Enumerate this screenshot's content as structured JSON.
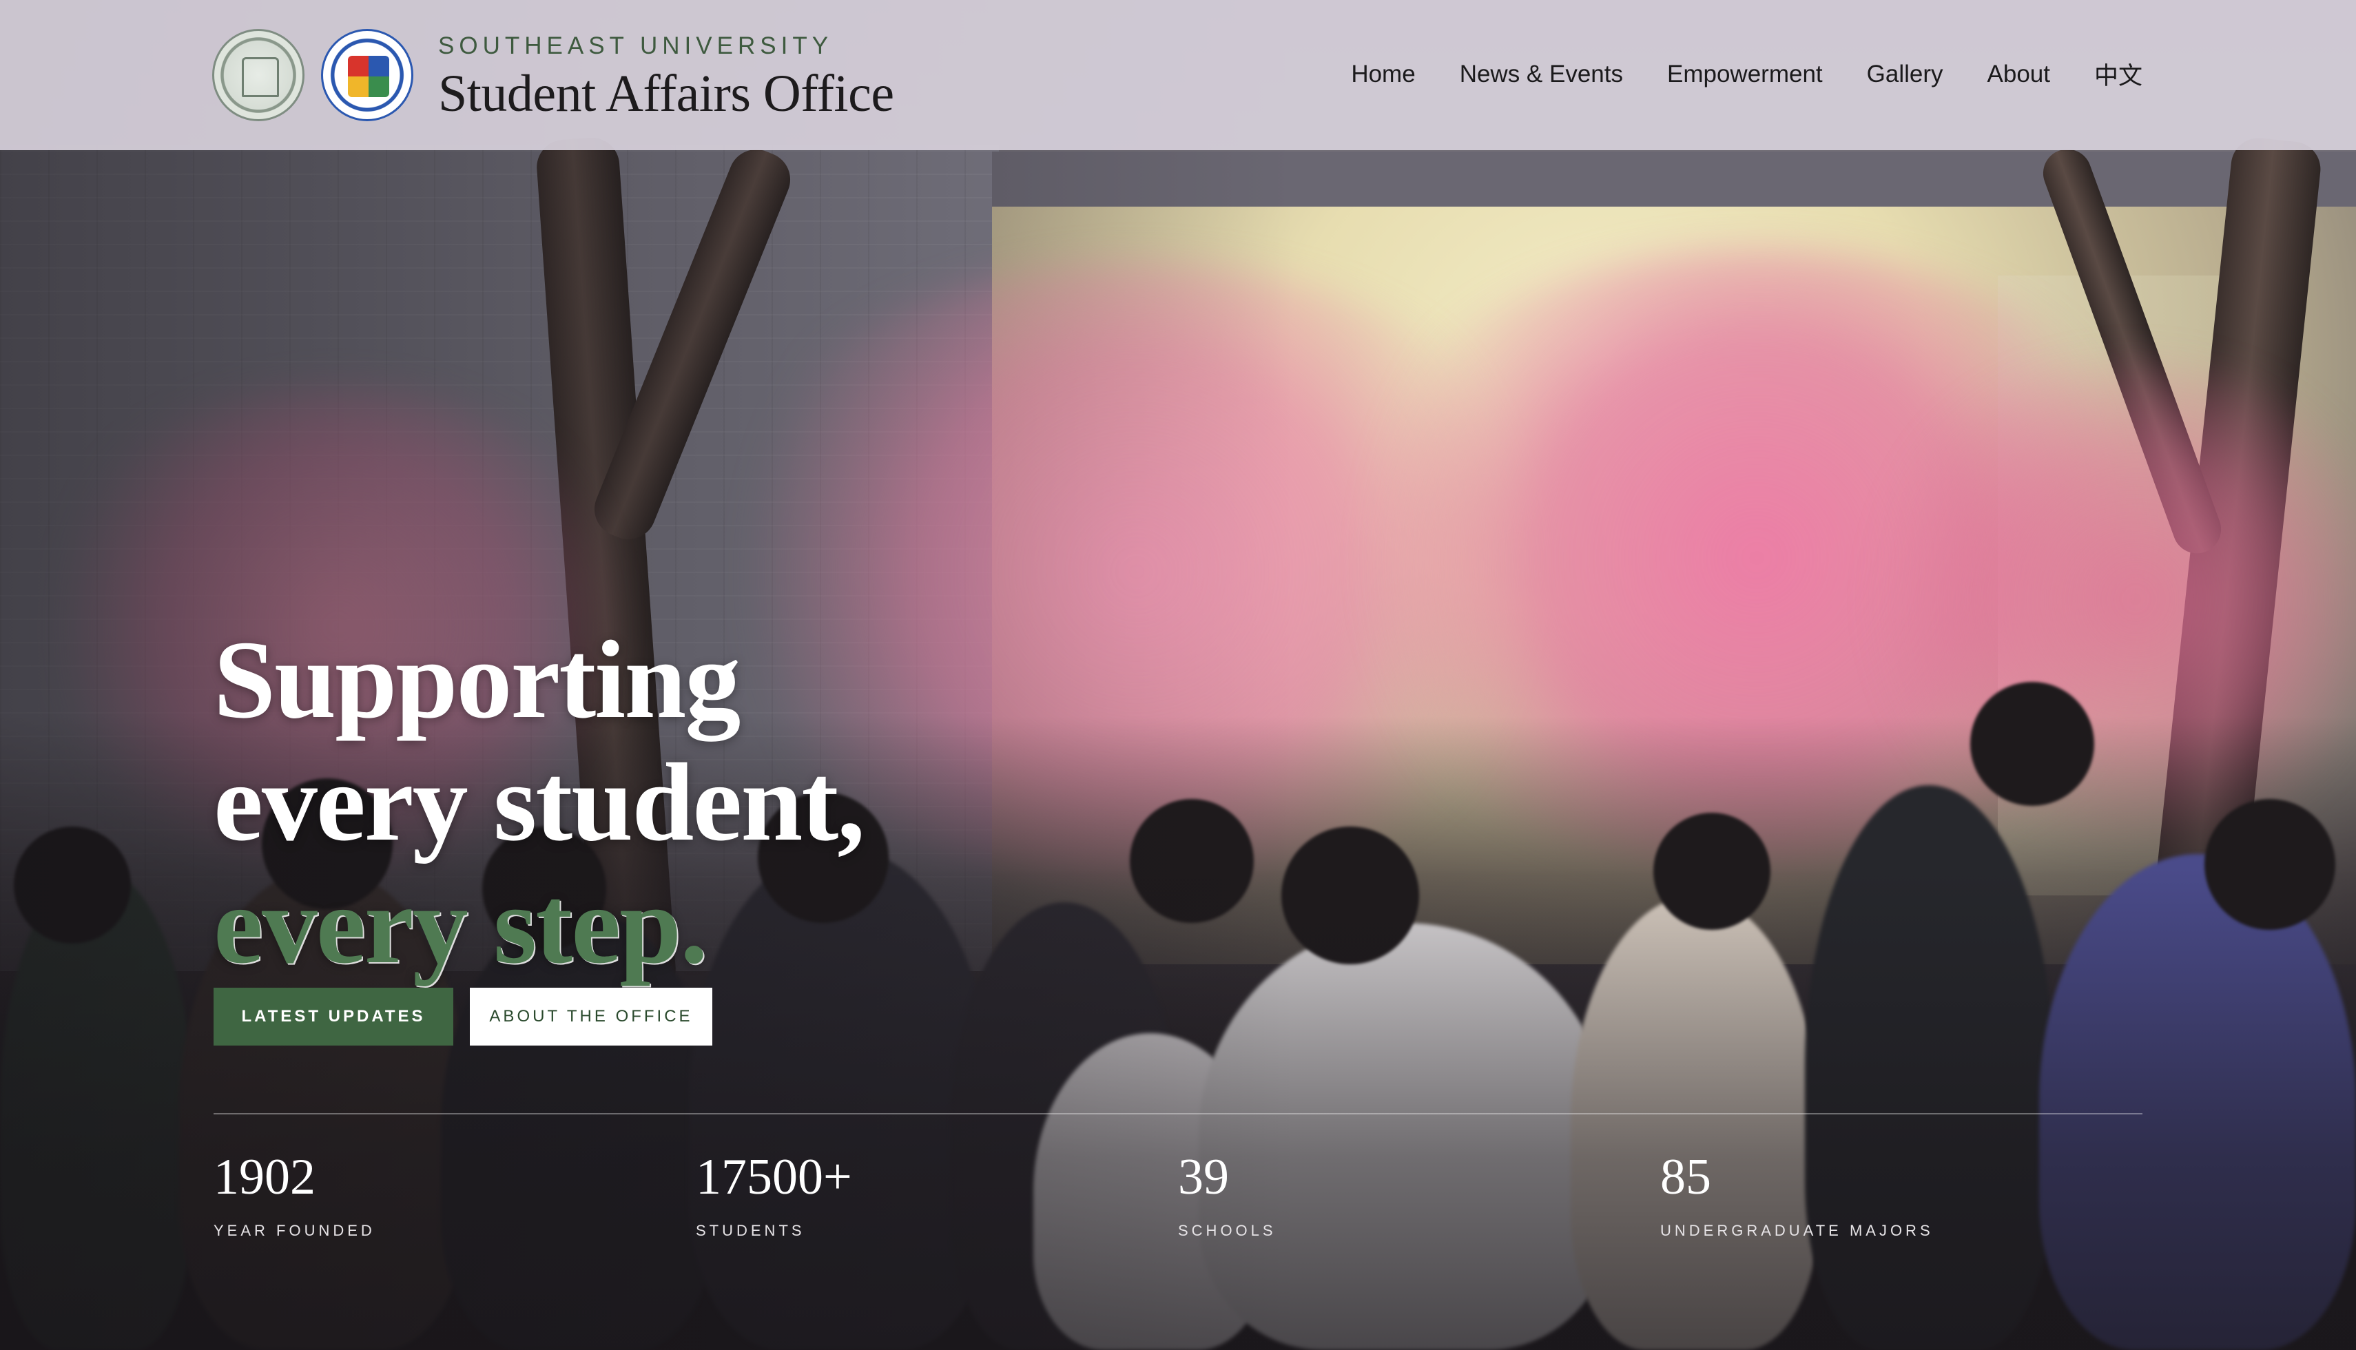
{
  "header": {
    "eyebrow": "SOUTHEAST UNIVERSITY",
    "title": "Student Affairs Office",
    "logos": [
      "university-seal-icon",
      "student-affairs-emblem-icon"
    ]
  },
  "nav": {
    "items": [
      {
        "label": "Home"
      },
      {
        "label": "News & Events"
      },
      {
        "label": "Empowerment"
      },
      {
        "label": "Gallery"
      },
      {
        "label": "About"
      },
      {
        "label": "中文"
      }
    ]
  },
  "hero": {
    "line1": "Supporting",
    "line2": "every student,",
    "line3": "every step.",
    "accent_color": "#4f7a52"
  },
  "cta": {
    "primary": "LATEST UPDATES",
    "secondary": "ABOUT THE OFFICE",
    "primary_color": "#3f6642"
  },
  "stats": [
    {
      "value": "1902",
      "label": "YEAR FOUNDED"
    },
    {
      "value": "17500+",
      "label": "STUDENTS"
    },
    {
      "value": "39",
      "label": "SCHOOLS"
    },
    {
      "value": "85",
      "label": "UNDERGRADUATE MAJORS"
    }
  ]
}
